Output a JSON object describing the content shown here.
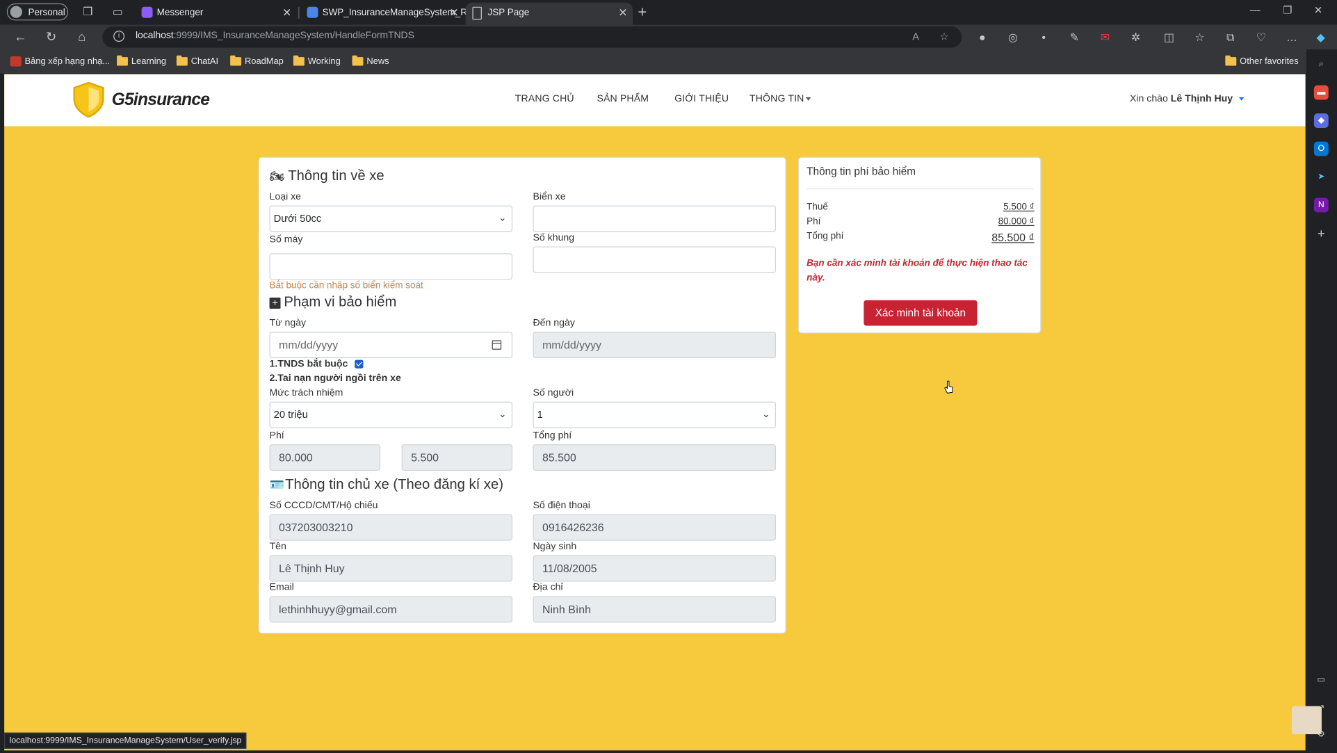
{
  "browser": {
    "profile_label": "Personal",
    "tabs": [
      {
        "title": "Messenger"
      },
      {
        "title": "SWP_InsuranceManageSystem_R"
      },
      {
        "title": "JSP Page"
      }
    ],
    "url_host": "localhost",
    "url_rest": ":9999/IMS_InsuranceManageSystem/HandleFormTNDS",
    "bookmarks": [
      "Bảng xếp hạng nhạ...",
      "Learning",
      "ChatAI",
      "RoadMap",
      "Working",
      "News"
    ],
    "other_favorites": "Other favorites",
    "status_url": "localhost:9999/IMS_InsuranceManageSystem/User_verify.jsp",
    "accent_color": "#1a73e8"
  },
  "site": {
    "brand": "G5insurance",
    "brand_color": "#f7ca3e",
    "nav": {
      "home": "TRANG CHỦ",
      "products": "SẢN PHẨM",
      "about": "GIỚI THIỆU",
      "info": "THÔNG TIN"
    },
    "greeting_prefix": "Xin chào",
    "user_name": "Lê Thịnh Huy"
  },
  "form": {
    "vehicle_section": "Thông tin về xe",
    "vehicle_type_label": "Loại xe",
    "vehicle_type_value": "Dưới 50cc",
    "plate_label": "Biển xe",
    "plate_value": "",
    "engine_label": "Số máy",
    "engine_value": "",
    "chassis_label": "Số khung",
    "chassis_value": "",
    "plate_warning": "Bắt buộc cần nhập số biển kiểm soát",
    "scope_section": "Phạm vi bảo hiểm",
    "from_label": "Từ ngày",
    "from_placeholder": "mm/dd/yyyy",
    "to_label": "Đến ngày",
    "to_placeholder": "mm/dd/yyyy",
    "tnds_label": "1.TNDS bắt buộc",
    "tnds_checked": true,
    "accident_label": "2.Tai nạn người ngồi trên xe",
    "liability_label": "Mức trách nhiệm",
    "liability_value": "20 triệu",
    "persons_label": "Số người",
    "persons_value": "1",
    "fee_label": "Phí",
    "fee_value": "80.000",
    "tax_value": "5.500",
    "total_label": "Tổng phí",
    "total_value": "85.500",
    "owner_section": "Thông tin chủ xe (Theo đăng kí xe)",
    "id_label": "Số CCCD/CMT/Hộ chiếu",
    "id_value": "037203003210",
    "phone_label": "Số điện thoại",
    "phone_value": "0916426236",
    "name_label": "Tên",
    "name_value": "Lê Thịnh Huy",
    "dob_label": "Ngày sinh",
    "dob_value": "11/08/2005",
    "email_label": "Email",
    "email_value": "lethinhhuyy@gmail.com",
    "address_label": "Địa chỉ",
    "address_value": "Ninh Bình"
  },
  "fee_panel": {
    "title": "Thông tin phí bảo hiểm",
    "tax_label": "Thuế",
    "tax_value": "5.500 ₫",
    "fee_label": "Phí",
    "fee_value": "80.000 ₫",
    "total_label": "Tổng phí",
    "total_value": "85.500 ₫",
    "error_text": "Bạn cần xác minh tài khoản để thực hiện thao tác này.",
    "verify_button": "Xác minh tài khoản",
    "error_color": "#c82333"
  }
}
